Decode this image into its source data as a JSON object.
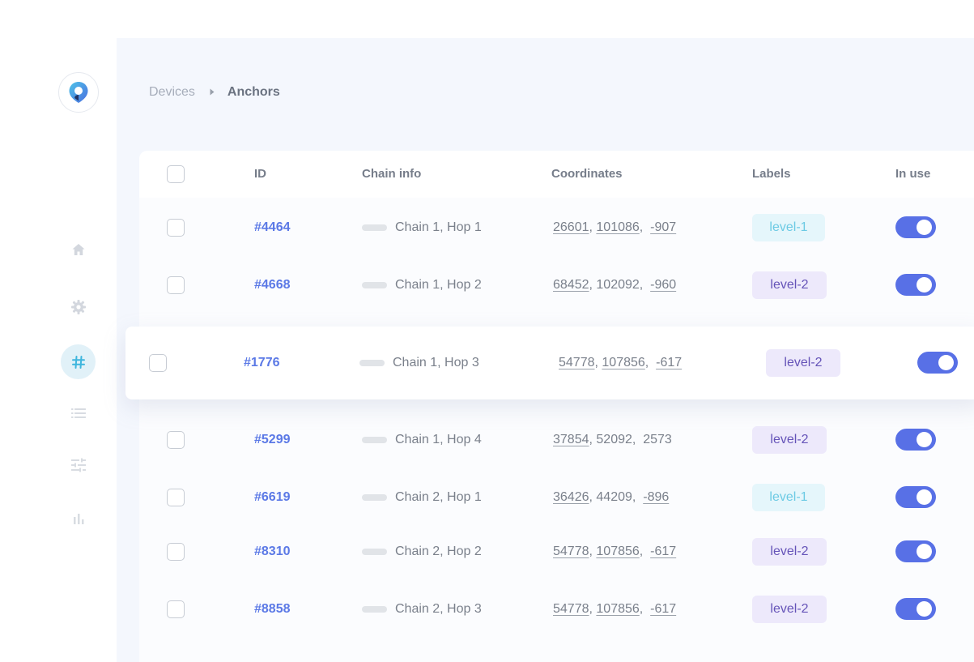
{
  "sidebar": {
    "logo": "location-pin-logo",
    "items": [
      {
        "icon": "home-icon"
      },
      {
        "icon": "gear-icon"
      },
      {
        "icon": "hash-icon",
        "active": true
      },
      {
        "icon": "list-icon"
      },
      {
        "icon": "sliders-icon"
      },
      {
        "icon": "bar-chart-icon"
      }
    ]
  },
  "breadcrumb": {
    "parent": "Devices",
    "current": "Anchors"
  },
  "table": {
    "columns": [
      "ID",
      "Chain info",
      "Coordinates",
      "Labels",
      "In use"
    ],
    "rows": [
      {
        "id": "#4464",
        "chain": "Chain 1, Hop 1",
        "x": "26601",
        "y": "101086",
        "z": "-907",
        "label": "level-1",
        "in_use": true
      },
      {
        "id": "#4668",
        "chain": "Chain 1, Hop 2",
        "x": "68452",
        "y": "102092",
        "z": "-960",
        "label": "level-2",
        "in_use": true
      },
      {
        "id": "#1776",
        "chain": "Chain 1, Hop 3",
        "x": "54778",
        "y": "107856",
        "z": "-617",
        "label": "level-2",
        "in_use": true
      },
      {
        "id": "#5299",
        "chain": "Chain 1, Hop 4",
        "x": "37854",
        "y": "52092",
        "z": "2573",
        "label": "level-2",
        "in_use": true
      },
      {
        "id": "#6619",
        "chain": "Chain 2, Hop 1",
        "x": "36426",
        "y": "44209",
        "z": "-896",
        "label": "level-1",
        "in_use": true
      },
      {
        "id": "#8310",
        "chain": "Chain 2, Hop 2",
        "x": "54778",
        "y": "107856",
        "z": "-617",
        "label": "level-2",
        "in_use": true
      },
      {
        "id": "#8858",
        "chain": "Chain 2, Hop 3",
        "x": "54778",
        "y": "107856",
        "z": "-617",
        "label": "level-2",
        "in_use": true
      }
    ]
  },
  "colors": {
    "accent": "#5870e6",
    "id_link": "#5b79e6",
    "level1_bg": "#e5f6fb",
    "level1_text": "#6ccae4",
    "level2_bg": "#ede9fb",
    "level2_text": "#6553b8"
  }
}
